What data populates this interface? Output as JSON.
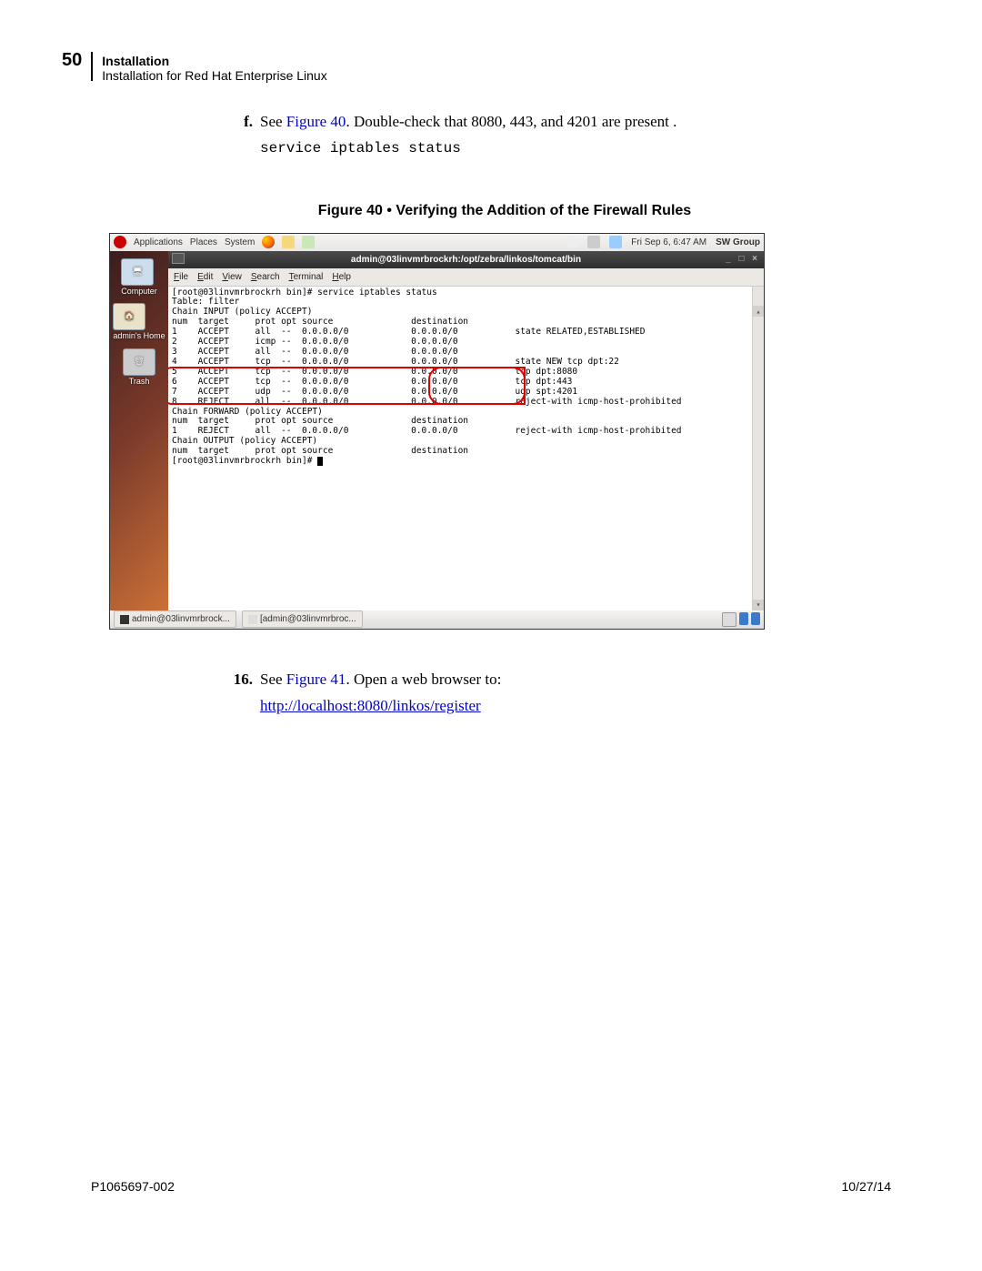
{
  "header": {
    "page_number": "50",
    "title": "Installation",
    "subtitle": "Installation for Red Hat Enterprise Linux"
  },
  "step_f": {
    "label": "f.",
    "prefix": "See ",
    "figure_link": "Figure 40",
    "suffix": ". Double-check that 8080, 443, and 4201 are present .",
    "command": "service iptables status"
  },
  "figure_caption": "Figure 40 • Verifying the Addition of the Firewall Rules",
  "gnome_panel": {
    "menus": [
      "Applications",
      "Places",
      "System"
    ],
    "clock": "Fri Sep  6,  6:47 AM",
    "user": "SW Group"
  },
  "desktop_icons": [
    {
      "label": "Computer"
    },
    {
      "label": "admin's Home"
    },
    {
      "label": "Trash"
    }
  ],
  "terminal": {
    "title": "admin@03linvmrbrockrh:/opt/zebra/linkos/tomcat/bin",
    "menus": [
      "File",
      "Edit",
      "View",
      "Search",
      "Terminal",
      "Help"
    ],
    "lines": [
      "[root@03linvmrbrockrh bin]# service iptables status",
      "Table: filter",
      "Chain INPUT (policy ACCEPT)",
      "num  target     prot opt source               destination",
      "1    ACCEPT     all  --  0.0.0.0/0            0.0.0.0/0           state RELATED,ESTABLISHED",
      "2    ACCEPT     icmp --  0.0.0.0/0            0.0.0.0/0",
      "3    ACCEPT     all  --  0.0.0.0/0            0.0.0.0/0",
      "4    ACCEPT     tcp  --  0.0.0.0/0            0.0.0.0/0           state NEW tcp dpt:22",
      "5    ACCEPT     tcp  --  0.0.0.0/0            0.0.0.0/0           tcp dpt:8080",
      "6    ACCEPT     tcp  --  0.0.0.0/0            0.0.0.0/0           tcp dpt:443",
      "7    ACCEPT     udp  --  0.0.0.0/0            0.0.0.0/0           udp spt:4201",
      "8    REJECT     all  --  0.0.0.0/0            0.0.0.0/0           reject-with icmp-host-prohibited",
      "",
      "Chain FORWARD (policy ACCEPT)",
      "num  target     prot opt source               destination",
      "1    REJECT     all  --  0.0.0.0/0            0.0.0.0/0           reject-with icmp-host-prohibited",
      "",
      "Chain OUTPUT (policy ACCEPT)",
      "num  target     prot opt source               destination",
      "",
      "[root@03linvmrbrockrh bin]# "
    ]
  },
  "taskbar": {
    "items": [
      "admin@03linvmrbrock...",
      "[admin@03linvmrbroc..."
    ]
  },
  "step_16": {
    "label": "16.",
    "prefix": "See ",
    "figure_link": "Figure 41",
    "suffix": ". Open a web browser to:",
    "url": "http://localhost:8080/linkos/register"
  },
  "footer": {
    "left": "P1065697-002",
    "right": "10/27/14"
  }
}
